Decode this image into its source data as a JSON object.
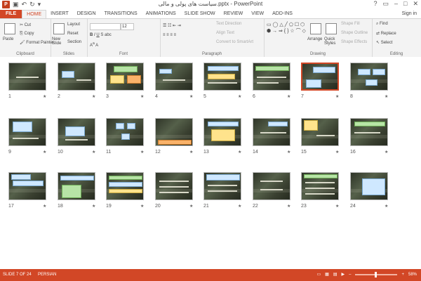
{
  "window": {
    "title": "سیاست های پولی و مالی.pptx - PowerPoint",
    "sign_in": "Sign in"
  },
  "tabs": [
    "FILE",
    "HOME",
    "INSERT",
    "DESIGN",
    "TRANSITIONS",
    "ANIMATIONS",
    "SLIDE SHOW",
    "REVIEW",
    "VIEW",
    "ADD-INS"
  ],
  "ribbon": {
    "clipboard": {
      "paste": "Paste",
      "cut": "Cut",
      "copy": "Copy",
      "format_painter": "Format Painter",
      "label": "Clipboard"
    },
    "slides": {
      "new_slide": "New Slide",
      "layout": "Layout",
      "reset": "Reset",
      "section": "Section",
      "label": "Slides"
    },
    "font": {
      "size": "12",
      "label": "Font"
    },
    "paragraph": {
      "text_direction": "Text Direction",
      "align_text": "Align Text",
      "convert": "Convert to SmartArt",
      "label": "Paragraph"
    },
    "drawing": {
      "arrange": "Arrange",
      "quick_styles": "Quick Styles",
      "shape_fill": "Shape Fill",
      "shape_outline": "Shape Outline",
      "shape_effects": "Shape Effects",
      "label": "Drawing"
    },
    "editing": {
      "find": "Find",
      "replace": "Replace",
      "select": "Select",
      "label": "Editing"
    }
  },
  "slides": [
    {
      "n": "1"
    },
    {
      "n": "2"
    },
    {
      "n": "3"
    },
    {
      "n": "4"
    },
    {
      "n": "5"
    },
    {
      "n": "6"
    },
    {
      "n": "7",
      "selected": true
    },
    {
      "n": "8"
    },
    {
      "n": "9"
    },
    {
      "n": "10"
    },
    {
      "n": "11"
    },
    {
      "n": "12"
    },
    {
      "n": "13"
    },
    {
      "n": "14"
    },
    {
      "n": "15"
    },
    {
      "n": "16"
    },
    {
      "n": "17"
    },
    {
      "n": "18"
    },
    {
      "n": "19"
    },
    {
      "n": "20"
    },
    {
      "n": "21"
    },
    {
      "n": "22"
    },
    {
      "n": "23"
    },
    {
      "n": "24"
    }
  ],
  "status": {
    "slide": "SLIDE 7 OF 24",
    "language": "PERSIAN",
    "zoom": "58%"
  },
  "colors": {
    "accent": "#d24726",
    "ribbon_bg": "#f3f3f3"
  }
}
